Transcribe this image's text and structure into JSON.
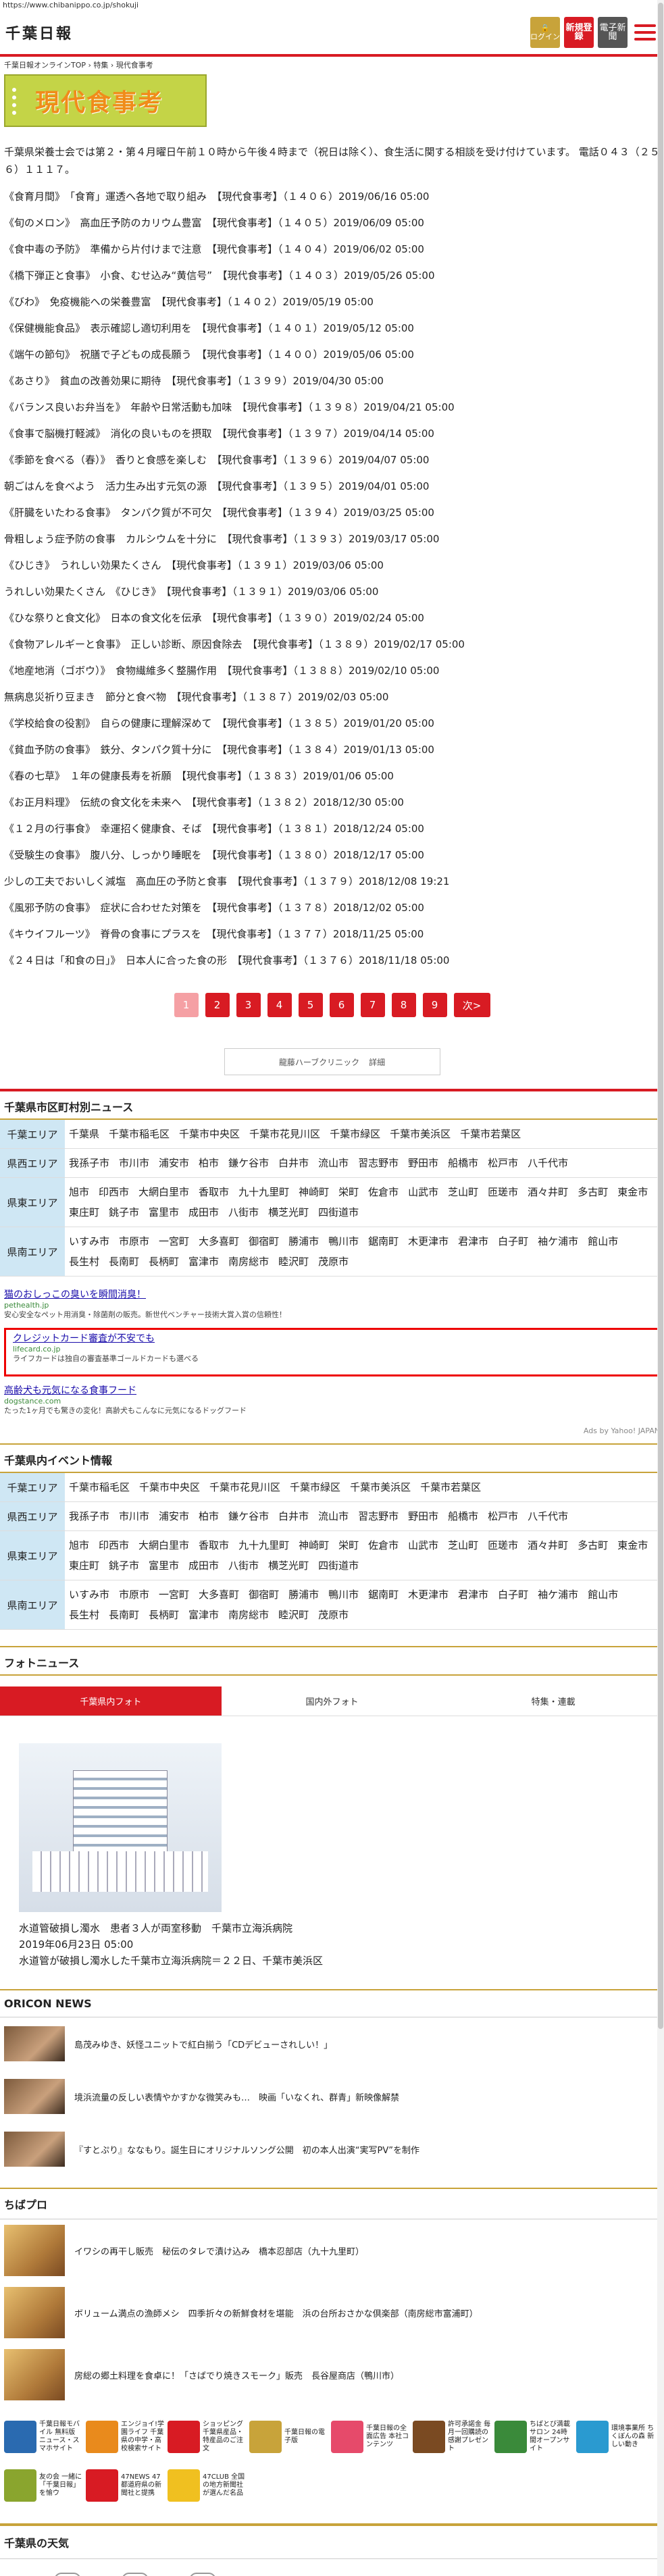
{
  "url": "https://www.chibanippo.co.jp/shokuji",
  "header": {
    "logo": "千葉日報",
    "login": "ログイン",
    "register": "新規登録",
    "epaper": "電子新聞"
  },
  "breadcrumb": "千葉日報オンラインTOP › 特集 › 現代食事考",
  "banner": "現代食事考",
  "intro": "千葉県栄養士会では第２・第４月曜日午前１０時から午後４時まで（祝日は除く）、食生活に関する相談を受け付けています。 電話０４３（２５６）１１１７。",
  "articles": [
    "《食育月間》　「食育」運透へ各地で取り組み　【現代食事考】（１４０６）2019/06/16 05:00",
    "《旬のメロン》　高血圧予防のカリウム豊富　【現代食事考】（１４０５）2019/06/09 05:00",
    "《食中毒の予防》　準備から片付けまで注意　【現代食事考】（１４０４）2019/06/02 05:00",
    "《橋下弾正と食事》　小食、むせ込み“黄信号”　【現代食事考】（１４０３）2019/05/26 05:00",
    "《びわ》　免疫機能への栄養豊富　【現代食事考】（１４０２）2019/05/19 05:00",
    "《保健機能食品》　表示確認し適切利用を　【現代食事考】（１４０１）2019/05/12 05:00",
    "《端午の節句》　祝膳で子どもの成長願う　【現代食事考】（１４００）2019/05/06 05:00",
    "《あさり》　貧血の改善効果に期待　【現代食事考】（１３９９）2019/04/30 05:00",
    "《バランス良いお弁当を》　年齢や日常活動も加味　【現代食事考】（１３９８）2019/04/21 05:00",
    "《食事で脳機打軽減》　消化の良いものを摂取　【現代食事考】（１３９７）2019/04/14 05:00",
    "《季節を食べる（春）》　香りと食感を楽しむ　【現代食事考】（１３９６）2019/04/07 05:00",
    "朝ごはんを食べよう　活力生み出す元気の源　【現代食事考】（１３９５）2019/04/01 05:00",
    "《肝臓をいたわる食事》　タンパク質が不可欠　【現代食事考】（１３９４）2019/03/25 05:00",
    "骨粗しょう症予防の食事　カルシウムを十分に　【現代食事考】（１３９３）2019/03/17 05:00",
    "《ひじき》　うれしい効果たくさん　【現代食事考】（１３９１）2019/03/06 05:00",
    "うれしい効果たくさん　《ひじき》　【現代食事考】（１３９１）2019/03/06 05:00",
    "《ひな祭りと食文化》　日本の食文化を伝承　【現代食事考】（１３９０）2019/02/24 05:00",
    "《食物アレルギーと食事》　正しい診断、原因食除去　【現代食事考】（１３８９）2019/02/17 05:00",
    "《地産地消（ゴボウ）》　食物繊維多く整腸作用　【現代食事考】（１３８８）2019/02/10 05:00",
    "無病息災祈り豆まき　節分と食べ物　【現代食事考】（１３８７）2019/02/03 05:00",
    "《学校給食の役割》　自らの健康に理解深めて　【現代食事考】（１３８５）2019/01/20 05:00",
    "《貧血予防の食事》　鉄分、タンパク質十分に　【現代食事考】（１３８４）2019/01/13 05:00",
    "《春の七草》　１年の健康長寿を祈願　【現代食事考】（１３８３）2019/01/06 05:00",
    "《お正月料理》　伝統の食文化を未来へ　【現代食事考】（１３８２）2018/12/30 05:00",
    "《１２月の行事食》　幸運招く健康食、そば　【現代食事考】（１３８１）2018/12/24 05:00",
    "《受験生の食事》　腹八分、しっかり睡眠を　【現代食事考】（１３８０）2018/12/17 05:00",
    "少しの工夫でおいしく減塩　高血圧の予防と食事　【現代食事考】（１３７９）2018/12/08 19:21",
    "《風邪予防の食事》　症状に合わせた対策を　【現代食事考】（１３７８）2018/12/02 05:00",
    "《キウイフルーツ》　脊骨の食事にプラスを　【現代食事考】（１３７７）2018/11/25 05:00",
    "《２４日は「和食の日」》　日本人に合った食の形　【現代食事考】（１３７６）2018/11/18 05:00"
  ],
  "pager": [
    "1",
    "2",
    "3",
    "4",
    "5",
    "6",
    "7",
    "8",
    "9",
    "次>"
  ],
  "ad_banner": {
    "text": "龍藤ハーブクリニック",
    "btn": "詳細"
  },
  "city_news": {
    "title": "千葉県市区町村別ニュース",
    "rows": [
      {
        "label": "千葉エリア",
        "items": [
          "千葉県",
          "千葉市稲毛区",
          "千葉市中央区",
          "千葉市花見川区",
          "千葉市緑区",
          "千葉市美浜区",
          "千葉市若葉区"
        ]
      },
      {
        "label": "県西エリア",
        "items": [
          "我孫子市",
          "市川市",
          "浦安市",
          "柏市",
          "鎌ケ谷市",
          "白井市",
          "流山市",
          "習志野市",
          "野田市",
          "船橋市",
          "松戸市",
          "八千代市"
        ]
      },
      {
        "label": "県東エリア",
        "items": [
          "旭市",
          "印西市",
          "大網白里市",
          "香取市",
          "九十九里町",
          "神崎町",
          "栄町",
          "佐倉市",
          "山武市",
          "芝山町",
          "匝瑳市",
          "酒々井町",
          "多古町",
          "東金市",
          "東庄町",
          "銚子市",
          "富里市",
          "成田市",
          "八街市",
          "横芝光町",
          "四街道市"
        ]
      },
      {
        "label": "県南エリア",
        "items": [
          "いすみ市",
          "市原市",
          "一宮町",
          "大多喜町",
          "御宿町",
          "勝浦市",
          "鴨川市",
          "鋸南町",
          "木更津市",
          "君津市",
          "白子町",
          "袖ケ浦市",
          "館山市",
          "長生村",
          "長南町",
          "長柄町",
          "富津市",
          "南房総市",
          "睦沢町",
          "茂原市"
        ]
      }
    ]
  },
  "ads": [
    {
      "title": "猫のおしっこの臭いを瞬間消臭！",
      "site": "pethealth.jp",
      "desc": "安心安全なペット用消臭・除菌剤の販売。新世代ベンチャー技術大賞入賞の信頼性！"
    },
    {
      "title": "クレジットカード審査が不安でも",
      "site": "lifecard.co.jp",
      "desc": "ライフカードは独自の審査基準ゴールドカードも選べる"
    },
    {
      "title": "高齢犬も元気になる食事フード",
      "site": "dogstance.com",
      "desc": "たった1ヶ月でも驚きの変化！高齢犬もこんなに元気になるドッグフード"
    }
  ],
  "ads_by": "Ads by Yahoo! JAPAN",
  "events": {
    "title": "千葉県内イベント情報",
    "rows": [
      {
        "label": "千葉エリア",
        "items": [
          "千葉市稲毛区",
          "千葉市中央区",
          "千葉市花見川区",
          "千葉市緑区",
          "千葉市美浜区",
          "千葉市若葉区"
        ]
      },
      {
        "label": "県西エリア",
        "items": [
          "我孫子市",
          "市川市",
          "浦安市",
          "柏市",
          "鎌ケ谷市",
          "白井市",
          "流山市",
          "習志野市",
          "野田市",
          "船橋市",
          "松戸市",
          "八千代市"
        ]
      },
      {
        "label": "県東エリア",
        "items": [
          "旭市",
          "印西市",
          "大網白里市",
          "香取市",
          "九十九里町",
          "神崎町",
          "栄町",
          "佐倉市",
          "山武市",
          "芝山町",
          "匝瑳市",
          "酒々井町",
          "多古町",
          "東金市",
          "東庄町",
          "銚子市",
          "富里市",
          "成田市",
          "八街市",
          "横芝光町",
          "四街道市"
        ]
      },
      {
        "label": "県南エリア",
        "items": [
          "いすみ市",
          "市原市",
          "一宮町",
          "大多喜町",
          "御宿町",
          "勝浦市",
          "鴨川市",
          "鋸南町",
          "木更津市",
          "君津市",
          "白子町",
          "袖ケ浦市",
          "館山市",
          "長生村",
          "長南町",
          "長柄町",
          "富津市",
          "南房総市",
          "睦沢町",
          "茂原市"
        ]
      }
    ]
  },
  "photo": {
    "title": "フォトニュース",
    "tabs": [
      "千葉県内フォト",
      "国内外フォト",
      "特集・連載"
    ],
    "caption1": "水道管破損し濁水　患者３人が両室移動　千葉市立海浜病院",
    "date": "2019年06月23日 05:00",
    "caption2": "水道管が破損し濁水した千葉市立海浜病院＝２２日、千葉市美浜区"
  },
  "oricon": {
    "title": "ORICON NEWS",
    "items": [
      "島茂みゆき、妖怪ユニットで紅白揃う「CDデビューされしい！」",
      "境浜流量の反しい表情やかすかな微笑みも…　映画「いなくれ、群青」新映像解禁",
      "『すとぷり』ななもり。誕生日にオリジナルソング公開　初の本人出演“実写PV”を制作"
    ]
  },
  "chibapro": {
    "title": "ちばプロ",
    "items": [
      "イワシの再干し販売　秘伝のタレで漬け込み　橋本忍部店（九十九里町）",
      "ボリューム満点の漁師メシ　四季折々の新鮮食材を堪能　浜の台所おさかな倶楽部（南房総市富浦町）",
      "房総の郷土料理を食卓に！「さばでり焼きスモーク」販売　長谷屋商店（鴨川市）"
    ]
  },
  "links": [
    "千葉日報モバイル 無料版 ニュース・スマホサイト",
    "エンジョイ!学園ライフ 千葉県の中学・高校検索サイト",
    "ショッピング 千葉県産品・特産品のご注文",
    "千葉日報の電子版",
    "千葉日報の全面広告 本社コンテンツ",
    "許可承諾金 毎月一回購読の感謝プレゼント",
    "ちばとび満載サロン 24時間オープンサイト",
    "環境事業所 ちくぼんの森 新しい動き",
    "友の会 一緒に「千葉日報」を愉ウ",
    "47NEWS 47都道府県の新聞社と提携",
    "47CLUB 全国の地方新聞社が選んだ名品"
  ],
  "weather": {
    "title": "千葉県の天気"
  },
  "colors": {
    "accent": "#d81b23",
    "gold": "#c8a33a",
    "area_label": "#cfe7f4",
    "banner": "#c4d447"
  }
}
